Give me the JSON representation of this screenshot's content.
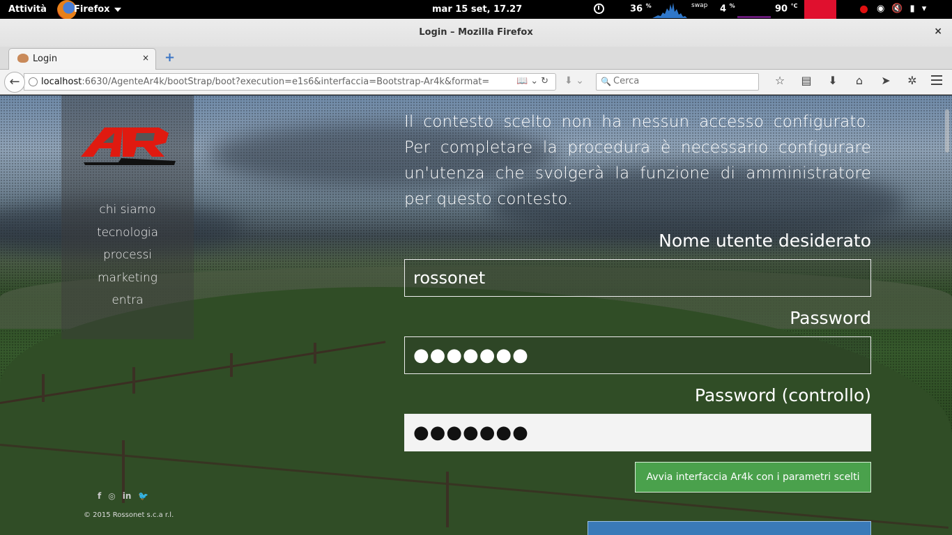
{
  "topbar": {
    "activities": "Attività",
    "app_name": "Firefox",
    "clock": "mar 15 set, 17.27",
    "cpu": "36",
    "cpu_unit": "%",
    "swap_label": "swap",
    "swap": "4",
    "swap_unit": "%",
    "temp": "90",
    "temp_unit": "°C",
    "icons": [
      "clock-icon",
      "record-icon",
      "wifi-icon",
      "volume-muted-icon",
      "battery-icon",
      "chevron-down-icon"
    ]
  },
  "window": {
    "title": "Login – Mozilla Firefox",
    "close": "×"
  },
  "tabs": [
    {
      "label": "Login",
      "close": "×"
    }
  ],
  "newtab": "+",
  "navbar": {
    "url_host": "localhost",
    "url_rest": ":6630/AgenteAr4k/bootStrap/boot?execution=e1s6&interfaccia=Bootstrap-Ar4k&format=",
    "search_placeholder": "Cerca",
    "toolbar_icons": [
      "bookmark-star-icon",
      "reading-list-icon",
      "download-icon",
      "home-icon",
      "send-icon",
      "extension-icon",
      "menu-icon"
    ]
  },
  "page": {
    "nav": [
      "chi siamo",
      "tecnologia",
      "processi",
      "marketing",
      "entra"
    ],
    "intro": "Il contesto scelto non ha nessun accesso configurato. Per completare la procedura è necessario configurare un'utenza che svolgerà la funzione di amministratore per questo contesto.",
    "username_label": "Nome utente desiderato",
    "username_value": "rossonet",
    "password_label": "Password",
    "password_value": "●●●●●●●",
    "password_check_label": "Password (controllo)",
    "password_check_value": "●●●●●●●",
    "submit_label": "Avvia interfaccia Ar4k con i parametri scelti",
    "social_icons": [
      "facebook-icon",
      "github-icon",
      "linkedin-icon",
      "twitter-icon"
    ],
    "social_glyphs": [
      "f",
      "◎",
      "in",
      "🐦"
    ],
    "copyright": "© 2015 Rossonet s.c.a r.l.",
    "colors": {
      "submit": "#4aa14c",
      "secondary": "#3a7ab8",
      "logo_red": "#e01a10"
    }
  }
}
